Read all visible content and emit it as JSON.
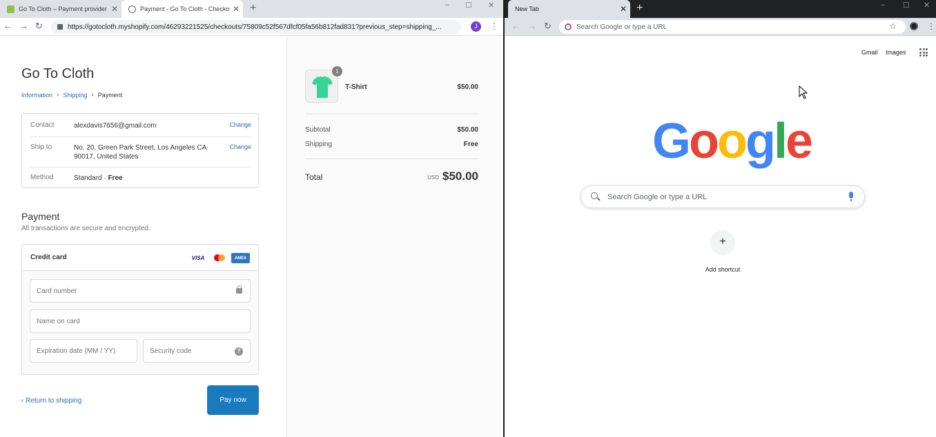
{
  "left_browser": {
    "tabs": [
      {
        "title": "Go To Cloth – Payment provider",
        "favicon": "shopify-icon"
      },
      {
        "title": "Payment - Go To Cloth - Checkout",
        "favicon": "globe-icon"
      }
    ],
    "new_tab": "+",
    "window_controls": [
      "–",
      "☐",
      "✕"
    ],
    "nav": {
      "back": "←",
      "forward": "→",
      "reload": "↻"
    },
    "url": "https://gotocloth.myshopify.com/46293221525/checkouts/75809c52f567dfcf05fa56b812fad831?previous_step=shipping_...",
    "profile_initial": "J",
    "menu": "⋮"
  },
  "checkout": {
    "store_name": "Go To Cloth",
    "breadcrumb": {
      "information": "Information",
      "shipping": "Shipping",
      "current": "Payment",
      "sep": "›"
    },
    "review": {
      "contact_label": "Contact",
      "contact_value": "alexdavis7656@gmail.com",
      "ship_label": "Ship to",
      "ship_value": "No. 20, Green Park Street, Los Angeles CA 90017, United States",
      "method_label": "Method",
      "method_value": "Standard · ",
      "method_price": "Free",
      "change": "Change"
    },
    "payment_title": "Payment",
    "payment_subtitle": "All transactions are secure and encrypted.",
    "credit_card_label": "Credit card",
    "card_logos": {
      "visa": "VISA",
      "amex": "AMEX"
    },
    "fields": {
      "card_number": "Card number",
      "name_on_card": "Name on card",
      "expiration": "Expiration date (MM / YY)",
      "security_code": "Security code",
      "help": "?"
    },
    "return_link": "‹ Return to shipping",
    "pay_button": "Pay now"
  },
  "summary": {
    "product_name": "T-Shirt",
    "product_price": "$50.00",
    "quantity": "1",
    "subtotal_label": "Subtotal",
    "subtotal_value": "$50.00",
    "shipping_label": "Shipping",
    "shipping_value": "Free",
    "total_label": "Total",
    "total_currency": "USD",
    "total_value": "$50.00"
  },
  "right_browser": {
    "tab_title": "New Tab",
    "tab_close": "✕",
    "new_tab": "+",
    "window_controls": [
      "–",
      "☐",
      "✕"
    ],
    "nav": {
      "back": "←",
      "forward": "→",
      "reload": "↻"
    },
    "omnibox_placeholder": "Search Google or type a URL",
    "star": "☆",
    "menu": "⋮",
    "gmail": "Gmail",
    "images": "Images",
    "logo_letters": [
      "G",
      "o",
      "o",
      "g",
      "l",
      "e"
    ],
    "logo_colors": [
      "#4285f4",
      "#ea4335",
      "#fbbc05",
      "#4285f4",
      "#34a853",
      "#ea4335"
    ],
    "search_placeholder": "Search Google or type a URL",
    "add_shortcut_icon": "+",
    "add_shortcut_label": "Add shortcut"
  }
}
